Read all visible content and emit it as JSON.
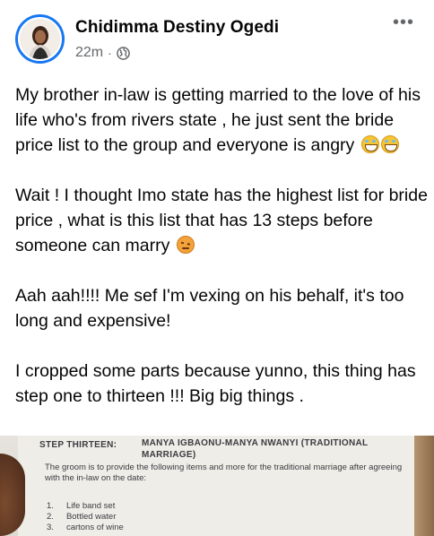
{
  "post": {
    "author": "Chidimma Destiny Ogedi",
    "time": "22m",
    "separator": "·",
    "privacy_icon": "globe-icon",
    "more_icon": "more-options-icon",
    "paragraphs": [
      "My brother in-law is getting married to the love of his life who's from rivers state , he just sent the bride price list to the group and everyone is angry",
      "Wait ! I thought Imo state has the highest list for bride price , what is this list that has 13 steps before someone can marry",
      "Aah aah!!!! Me sef I'm vexing on his behalf, it's too long and expensive!",
      "I cropped some parts because yunno, this thing has step one to thirteen !!! Big big things ."
    ]
  },
  "document": {
    "step_label": "STEP THIRTEEN:",
    "step_title": "MANYA IGBAONU-MANYA NWANYI (TRADITIONAL MARRIAGE)",
    "paragraph": "The groom is to provide the following items and more for the traditional marriage after agreeing with the in-law on the date:",
    "items": [
      {
        "num": "1.",
        "text": "Life band set"
      },
      {
        "num": "2.",
        "text": "Bottled water"
      },
      {
        "num": "3.",
        "text": "cartons of wine"
      }
    ]
  },
  "colors": {
    "accent": "#1877f2",
    "meta_text": "#65676b",
    "text": "#050505"
  }
}
